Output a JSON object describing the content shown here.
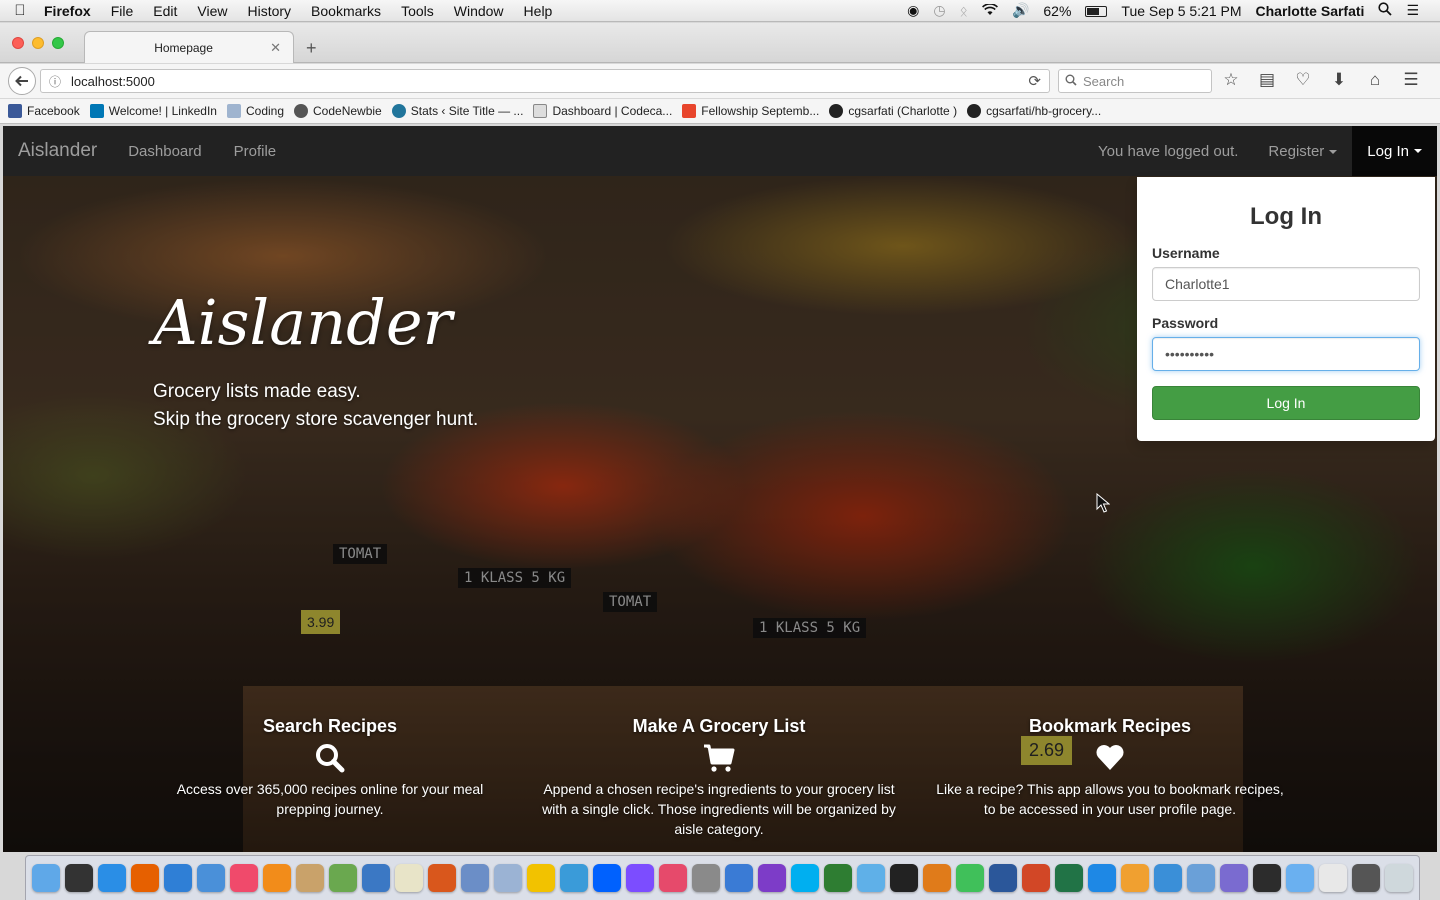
{
  "menubar": {
    "app": "Firefox",
    "items": [
      "File",
      "Edit",
      "View",
      "History",
      "Bookmarks",
      "Tools",
      "Window",
      "Help"
    ],
    "battery": "62%",
    "clock": "Tue Sep 5  5:21 PM",
    "user": "Charlotte Sarfati"
  },
  "browser": {
    "tab_title": "Homepage",
    "url": "localhost:5000",
    "search_placeholder": "Search",
    "bookmarks": [
      {
        "label": "Facebook",
        "color": "#3b5998"
      },
      {
        "label": "Welcome! | LinkedIn",
        "color": "#0077b5"
      },
      {
        "label": "Coding",
        "color": "#9fb4cf"
      },
      {
        "label": "CodeNewbie",
        "color": "#555555"
      },
      {
        "label": "Stats ‹ Site Title — ...",
        "color": "#21759b"
      },
      {
        "label": "Dashboard | Codeca...",
        "color": "#dddddd"
      },
      {
        "label": "Fellowship Septemb...",
        "color": "#e8452c"
      },
      {
        "label": "cgsarfati (Charlotte )",
        "color": "#222222"
      },
      {
        "label": "cgsarfati/hb-grocery...",
        "color": "#222222"
      }
    ]
  },
  "navbar": {
    "brand": "Aislander",
    "links": [
      "Dashboard",
      "Profile"
    ],
    "status": "You have logged out.",
    "register": "Register",
    "login": "Log In"
  },
  "hero": {
    "title": "Aislander",
    "tagline_1": "Grocery lists made easy.",
    "tagline_2": "Skip the grocery store scavenger hunt.",
    "crate_labels": [
      "TOMAT",
      "1 KLASS 5 KG",
      "TOMAT",
      "1 KLASS 5 KG"
    ],
    "price_tags": [
      "3.99",
      "2.69"
    ]
  },
  "features": [
    {
      "title": "Search Recipes",
      "icon": "search-icon",
      "text_1": "Access over 365,000 recipes online for your meal",
      "text_2": "prepping journey.",
      "text_3": ""
    },
    {
      "title": "Make A Grocery List",
      "icon": "cart-icon",
      "text_1": "Append a chosen recipe's ingredients to your grocery list",
      "text_2": "with a single click. Those ingredients will be organized by",
      "text_3": "aisle category."
    },
    {
      "title": "Bookmark Recipes",
      "icon": "heart-icon",
      "text_1": "Like a recipe? This app allows you to bookmark recipes,",
      "text_2": "to be accessed in your user profile page.",
      "text_3": ""
    }
  ],
  "login_form": {
    "heading": "Log In",
    "username_label": "Username",
    "username_value": "Charlotte1",
    "password_label": "Password",
    "password_value": "••••••••••",
    "submit": "Log In",
    "button_color": "#449d44"
  },
  "dock": {
    "app_colors": [
      "#5fa8e8",
      "#333333",
      "#2a8ee6",
      "#e66000",
      "#2f7fd6",
      "#4a90d9",
      "#f04a6b",
      "#f28c1a",
      "#c9a26a",
      "#6aa84f",
      "#3b78c4",
      "#e8e4c8",
      "#d9571c",
      "#6b8ec7",
      "#9bb3d4",
      "#f2c200",
      "#3a9bd9",
      "#0061fe",
      "#7c4dff",
      "#e64a6b",
      "#8a8a8a",
      "#3a7bd5",
      "#7d3cc8",
      "#00aff0",
      "#2e7d32",
      "#5fb0e8",
      "#222222",
      "#e07b1a",
      "#40c05a",
      "#2b579a",
      "#d24726",
      "#217346",
      "#1e88e5",
      "#f0a030",
      "#3a8fd8",
      "#6aa0d8",
      "#7a6bd0",
      "#2c2c2c",
      "#6ab0f0",
      "#e8e8e8",
      "#555555",
      "#cfd8dc"
    ]
  }
}
